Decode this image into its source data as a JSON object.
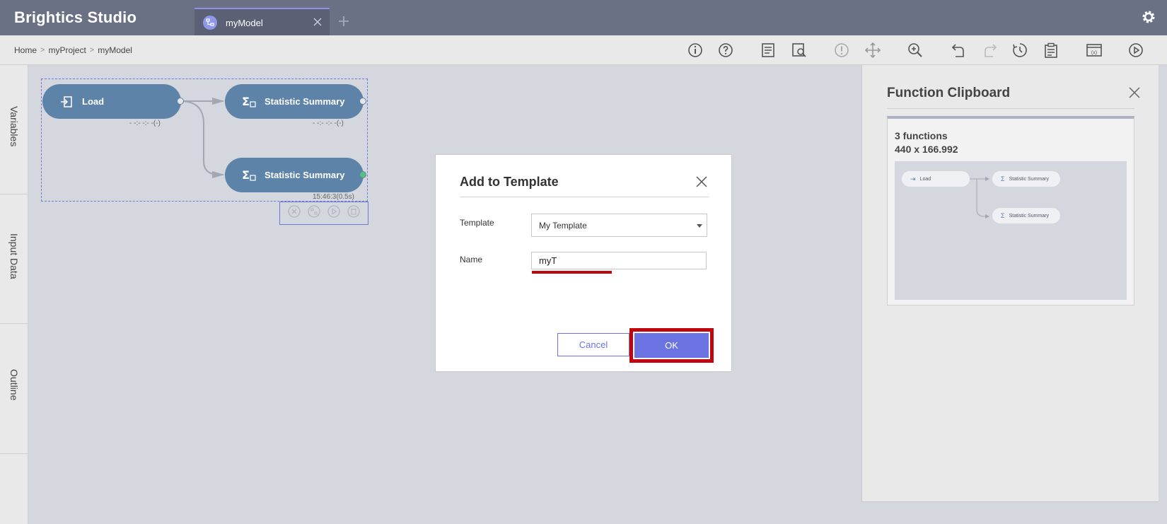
{
  "app": {
    "brand": "Brightics Studio"
  },
  "tabs": [
    {
      "label": "myModel",
      "icon": "model-icon"
    }
  ],
  "breadcrumb": [
    "Home",
    "myProject",
    "myModel"
  ],
  "toolbar_icons": [
    "info-icon",
    "help-icon",
    "report-icon",
    "preview-icon",
    "validate-icon",
    "move-icon",
    "zoom-in-icon",
    "undo-icon",
    "redo-icon",
    "history-icon",
    "clipboard-icon",
    "variables-icon",
    "run-icon"
  ],
  "rail": {
    "items": [
      "Variables",
      "Input Data",
      "Outline"
    ]
  },
  "canvas": {
    "nodes": [
      {
        "label": "Load",
        "status": "- -:- -:- -(-)"
      },
      {
        "label": "Statistic Summary",
        "status": "- -:- -:- -(-)"
      },
      {
        "label": "Statistic Summary",
        "status": "15:46:3(0.5s)"
      }
    ]
  },
  "clipboard": {
    "title": "Function Clipboard",
    "count": "3 functions",
    "size": "440 x 166.992",
    "preview_nodes": [
      "Load",
      "Statistic Summary",
      "Statistic Summary"
    ]
  },
  "modal": {
    "title": "Add to Template",
    "template_label": "Template",
    "template_value": "My Template",
    "name_label": "Name",
    "name_value": "myT",
    "cancel_label": "Cancel",
    "ok_label": "OK"
  },
  "colors": {
    "header": "#6b7185",
    "node": "#5d83a8",
    "accent": "#6b73e3",
    "highlight": "#c0050f"
  }
}
